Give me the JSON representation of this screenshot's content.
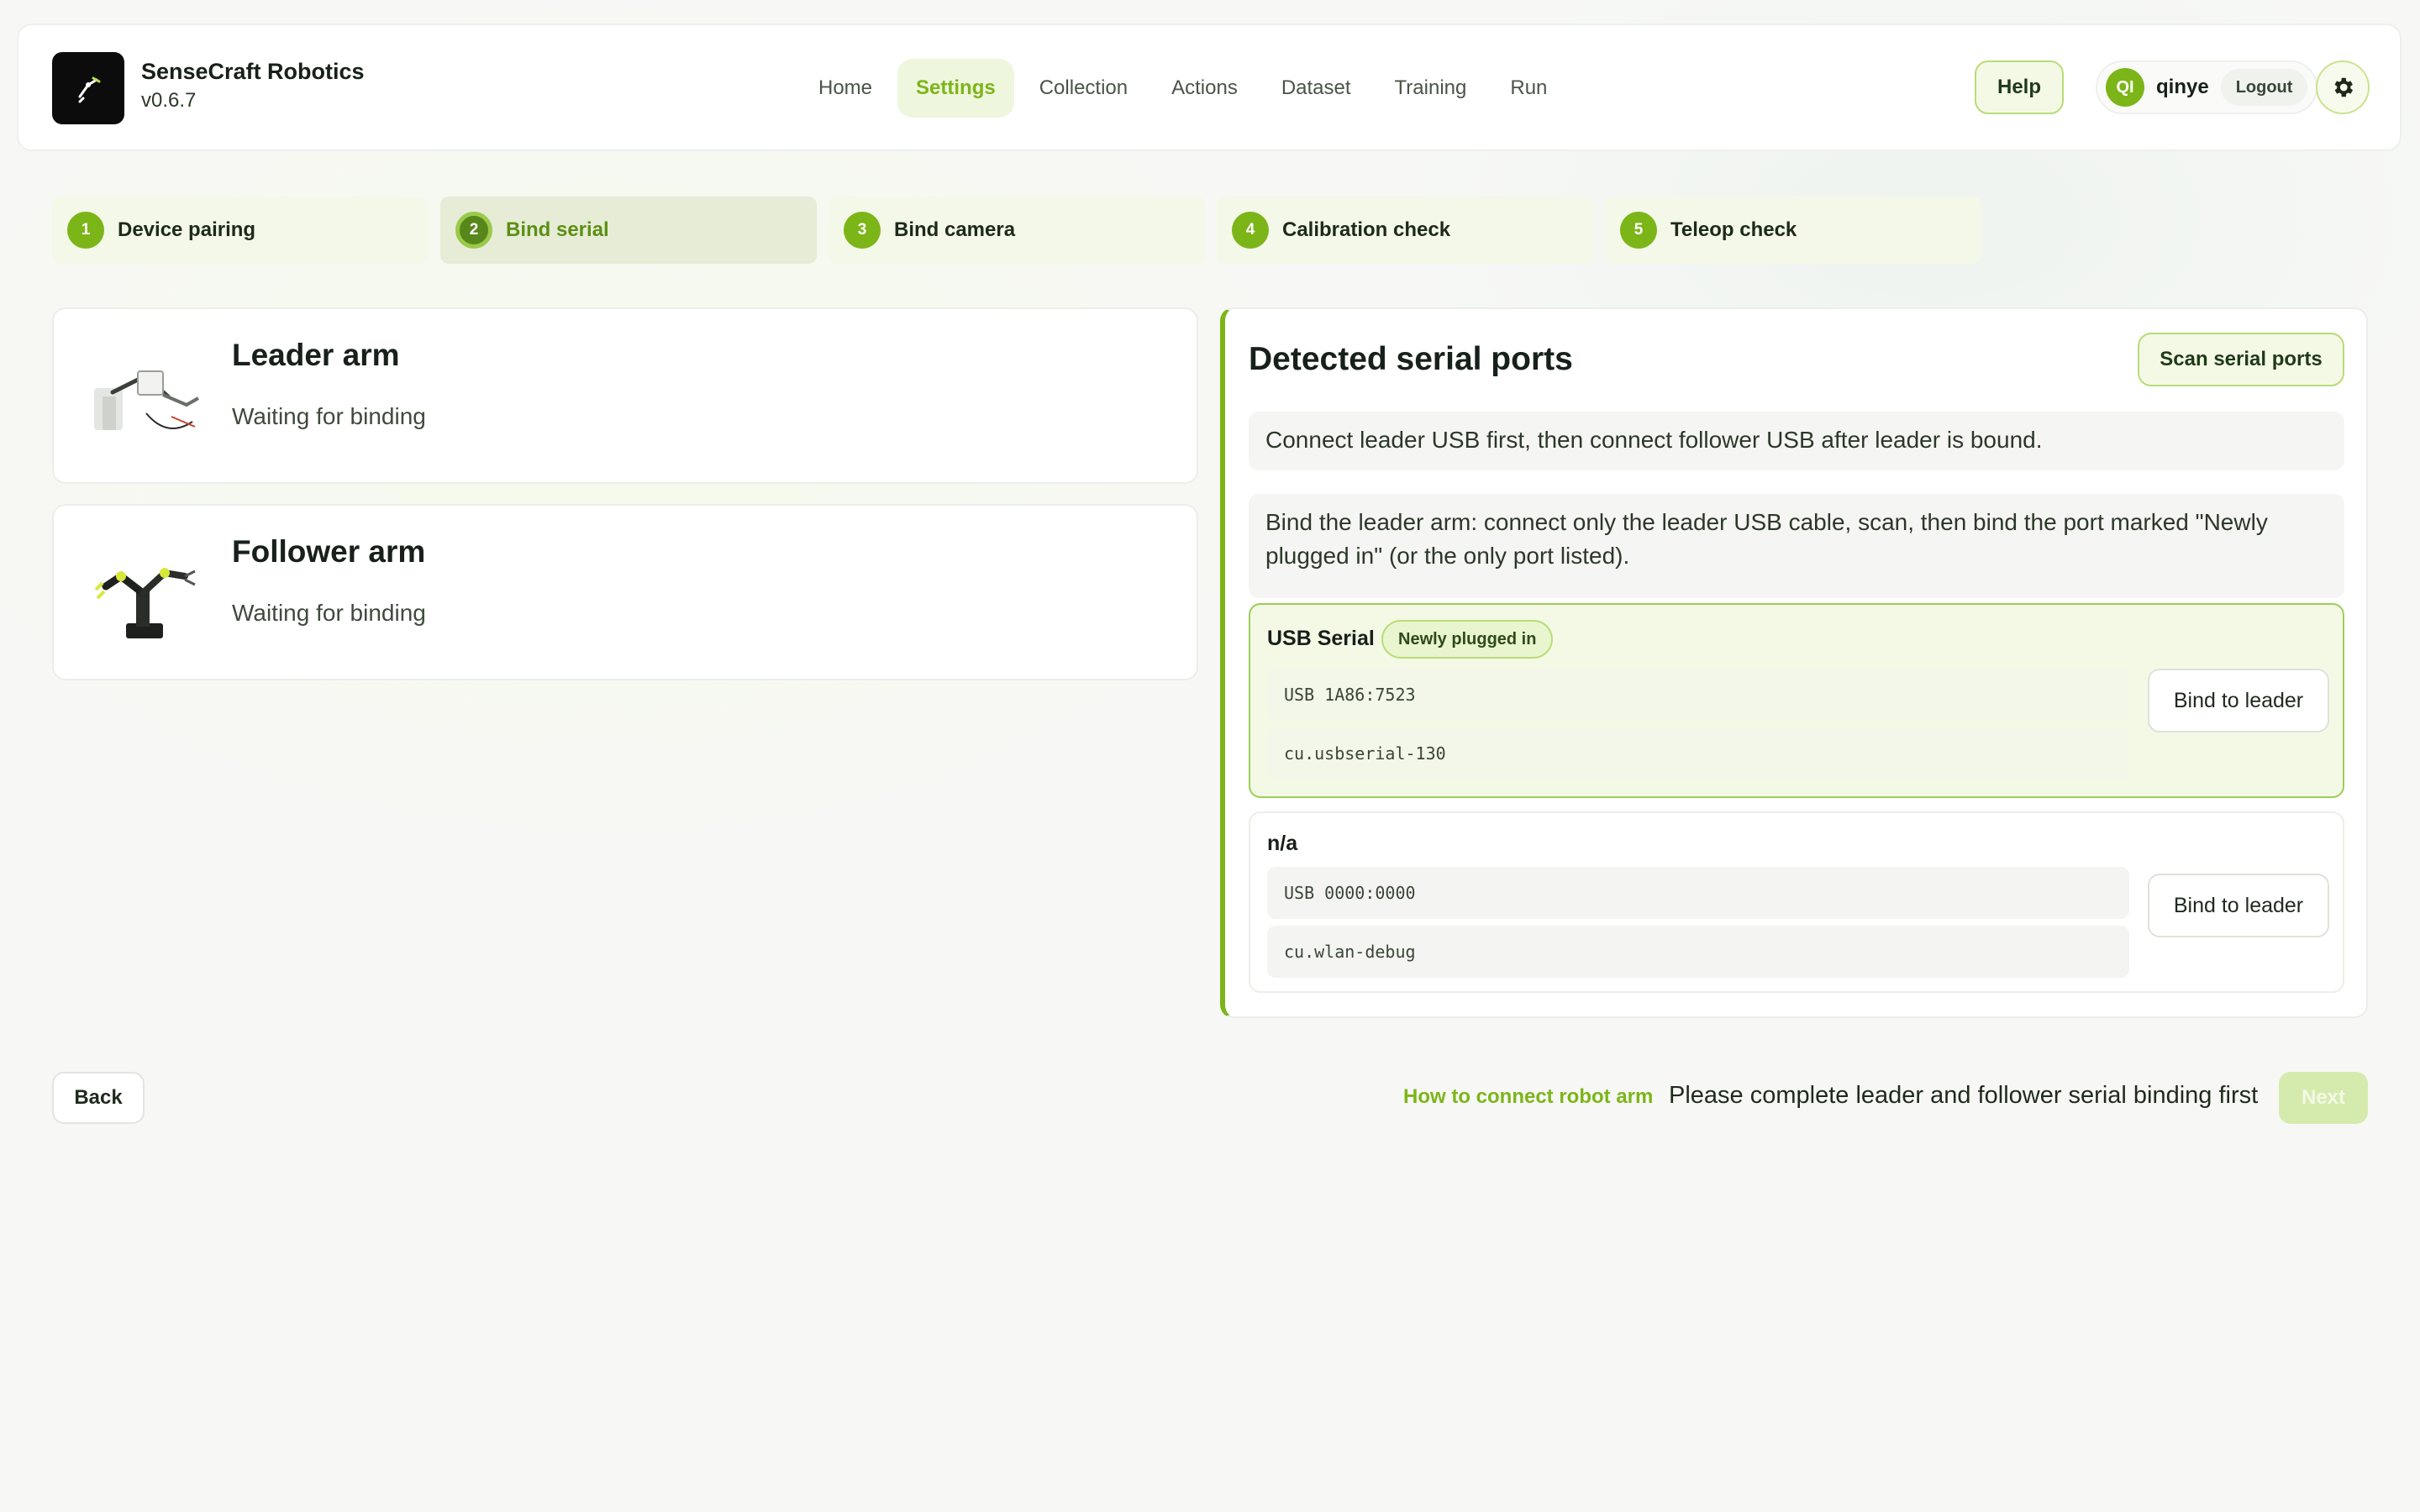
{
  "app": {
    "name": "SenseCraft Robotics",
    "version": "v0.6.7"
  },
  "nav": {
    "items": [
      {
        "label": "Home",
        "active": false
      },
      {
        "label": "Settings",
        "active": true
      },
      {
        "label": "Collection",
        "active": false
      },
      {
        "label": "Actions",
        "active": false
      },
      {
        "label": "Dataset",
        "active": false
      },
      {
        "label": "Training",
        "active": false
      },
      {
        "label": "Run",
        "active": false
      }
    ]
  },
  "header": {
    "help_label": "Help",
    "user_initials": "QI",
    "user_name": "qinye",
    "logout_label": "Logout",
    "settings_icon": "gear-icon"
  },
  "steps": [
    {
      "num": "1",
      "label": "Device pairing",
      "active": false
    },
    {
      "num": "2",
      "label": "Bind serial",
      "active": true
    },
    {
      "num": "3",
      "label": "Bind camera",
      "active": false
    },
    {
      "num": "4",
      "label": "Calibration check",
      "active": false
    },
    {
      "num": "5",
      "label": "Teleop check",
      "active": false
    }
  ],
  "arms": [
    {
      "title": "Leader arm",
      "status": "Waiting for binding"
    },
    {
      "title": "Follower arm",
      "status": "Waiting for binding"
    }
  ],
  "serial": {
    "title": "Detected serial ports",
    "scan_label": "Scan serial ports",
    "info1": "Connect leader USB first, then connect follower USB after leader is bound.",
    "info2": "Bind the leader arm: connect only the leader USB cable, scan, then bind the port marked \"Newly plugged in\" (or the only port listed).",
    "ports": [
      {
        "name": "USB Serial",
        "badge": "Newly plugged in",
        "usb_id": "USB 1A86:7523",
        "device": "cu.usbserial-130",
        "bind_label": "Bind to leader"
      },
      {
        "name": "n/a",
        "usb_id": "USB 0000:0000",
        "device": "cu.wlan-debug",
        "bind_label": "Bind to leader"
      }
    ]
  },
  "footer": {
    "back_label": "Back",
    "help_link": "How to connect robot arm",
    "message": "Please complete leader and follower serial binding first",
    "next_label": "Next"
  },
  "colors": {
    "accent": "#7cb518",
    "accent_light": "#eef6dd"
  }
}
